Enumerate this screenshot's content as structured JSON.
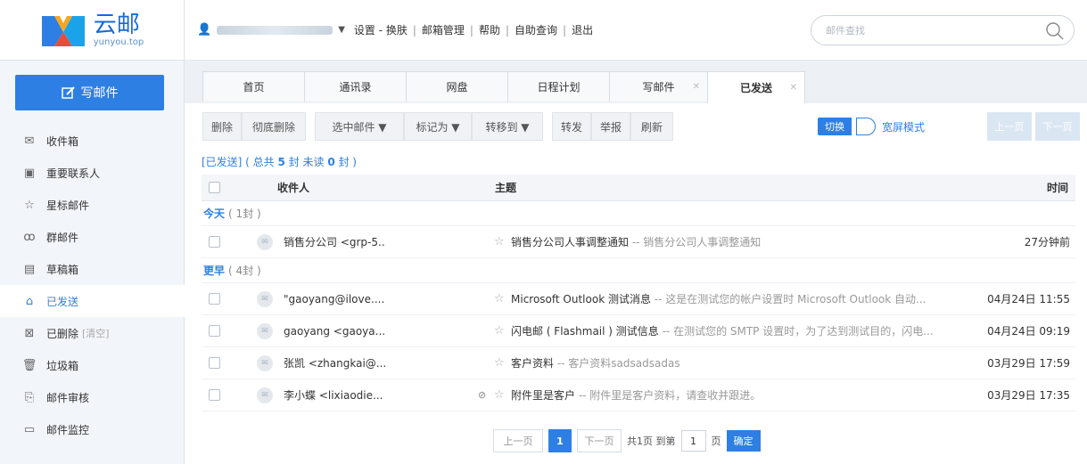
{
  "brand": {
    "name": "云邮",
    "domain": "yunyou.top"
  },
  "compose_label": "写邮件",
  "nav": [
    {
      "label": "收件箱",
      "icon": "envelope-icon"
    },
    {
      "label": "重要联系人",
      "icon": "contact-icon"
    },
    {
      "label": "星标邮件",
      "icon": "star-icon"
    },
    {
      "label": "群邮件",
      "icon": "group-icon"
    },
    {
      "label": "草稿箱",
      "icon": "draft-icon"
    },
    {
      "label": "已发送",
      "icon": "sent-icon",
      "active": true
    },
    {
      "label": "已删除",
      "icon": "deleted-icon",
      "extra": "[清空]"
    },
    {
      "label": "垃圾箱",
      "icon": "trash-icon"
    },
    {
      "label": "邮件审核",
      "icon": "audit-icon"
    },
    {
      "label": "邮件监控",
      "icon": "monitor-icon"
    }
  ],
  "topbar": {
    "links": [
      "设置 - 换肤",
      "邮箱管理",
      "帮助",
      "自助查询",
      "退出"
    ],
    "search_placeholder": "邮件查找"
  },
  "tabs": [
    {
      "label": "首页"
    },
    {
      "label": "通讯录"
    },
    {
      "label": "网盘"
    },
    {
      "label": "日程计划"
    },
    {
      "label": "写邮件",
      "closable": true
    },
    {
      "label": "已发送",
      "closable": true,
      "active": true
    }
  ],
  "toolbar": {
    "delete": "删除",
    "delete_forever": "彻底删除",
    "select": "选中邮件 ▼",
    "mark": "标记为 ▼",
    "move": "转移到 ▼",
    "forward": "转发",
    "report": "举报",
    "refresh": "刷新",
    "switch": "切换",
    "widescreen": "宽屏模式",
    "prev": "上一页",
    "next": "下一页"
  },
  "summary": {
    "prefix": "[已发送] ( 总共 ",
    "total": "5",
    "mid": " 封 未读 ",
    "unread": "0",
    "suffix": " 封 )"
  },
  "table": {
    "col_recipient": "收件人",
    "col_subject": "主题",
    "col_time": "时间",
    "groups": [
      {
        "label": "今天",
        "count": "( 1封 )"
      },
      {
        "label": "更早",
        "count": "( 4封 )"
      }
    ],
    "rows": [
      {
        "recipient": "销售分公司 <grp-5..",
        "subject": "销售分公司人事调整通知",
        "preview": " -- 销售分公司人事调整通知",
        "time": "27分钟前",
        "attachment": false
      },
      {
        "recipient": "\"gaoyang@ilove....",
        "subject": "Microsoft Outlook 测试消息",
        "preview": " -- 这是在测试您的帐户设置时 Microsoft Outlook 自动...",
        "time": "04月24日 11:55",
        "attachment": false
      },
      {
        "recipient": "gaoyang <gaoya...",
        "subject": "闪电邮 ( Flashmail ) 测试信息",
        "preview": " -- 在测试您的 SMTP 设置时，为了达到测试目的，闪电...",
        "time": "04月24日 09:19",
        "attachment": false
      },
      {
        "recipient": "张凯 <zhangkai@...",
        "subject": "客户资料",
        "preview": " -- 客户资料sadsadsadas",
        "time": "03月29日 17:59",
        "attachment": false
      },
      {
        "recipient": "李小蝶 <lixiaodie...",
        "subject": "附件里是客户",
        "preview": " -- 附件里是客户资料，请查收并跟进。",
        "time": "03月29日 17:35",
        "attachment": true
      }
    ]
  },
  "pager": {
    "prev": "上一页",
    "current": "1",
    "next": "下一页",
    "total_text": "共1页 到第",
    "page_value": "1",
    "page_unit": "页",
    "confirm": "确定"
  },
  "colors": {
    "accent": "#2e7fe3",
    "sidebar_bg": "#f2f5f9"
  }
}
